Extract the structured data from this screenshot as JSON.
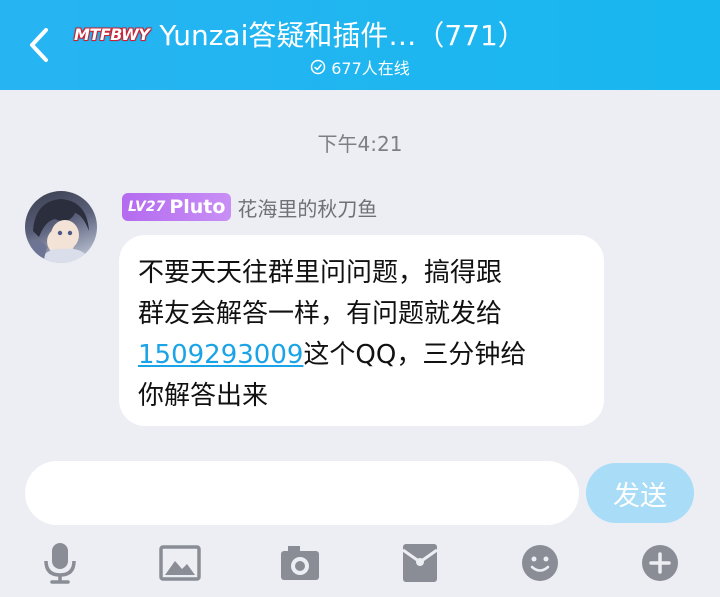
{
  "header": {
    "logo_text": "MTFBWY",
    "title": "Yunzai答疑和插件…（771）",
    "online_status": "677人在线",
    "back_icon": "chevron-left-icon",
    "online_icon": "check-circle-icon"
  },
  "chat": {
    "timestamp": "下午4:21",
    "message": {
      "level_prefix": "LV27",
      "level_title": "Pluto",
      "sender_name": "花海里的秋刀鱼",
      "lines": [
        "不要天天往群里问问题，搞得跟",
        "群友会解答一样，有问题就发给"
      ],
      "link_text": "1509293009",
      "line3_rest": "这个QQ，三分钟给",
      "line4": "你解答出来"
    }
  },
  "input": {
    "placeholder": "",
    "send_label": "发送"
  },
  "toolbar": {
    "items": [
      "microphone-icon",
      "image-icon",
      "camera-icon",
      "red-packet-icon",
      "emoji-icon",
      "plus-icon"
    ]
  },
  "colors": {
    "header_bg": "#1fb5f0",
    "level_badge": "#b46bf0",
    "link": "#1aa3e6",
    "send_button": "#a8dcf7",
    "icon_gray": "#8a8d95"
  }
}
